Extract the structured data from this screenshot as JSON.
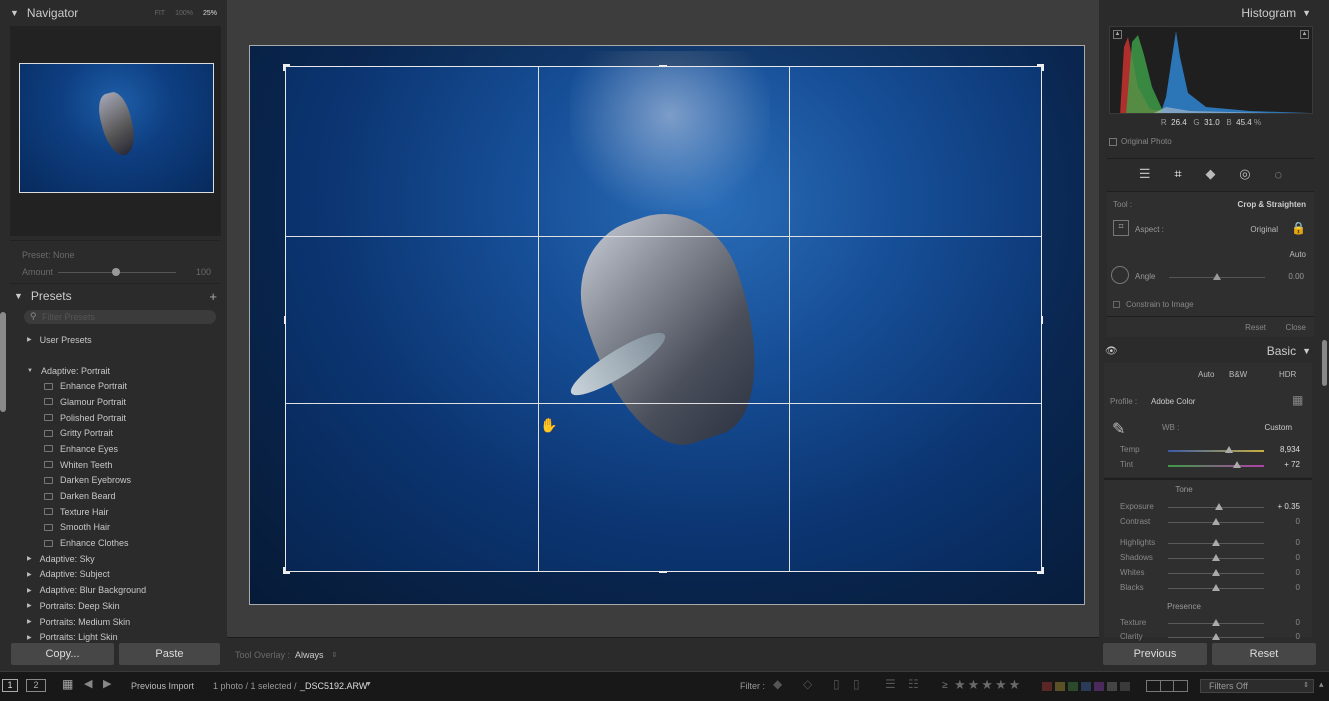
{
  "navigator": {
    "title": "Navigator",
    "fit": "FIT",
    "zoom1": "100%",
    "zoom2": "25%"
  },
  "preset_amount": {
    "preset_label": "Preset: None",
    "amount_label": "Amount",
    "amount_value": "100"
  },
  "presets": {
    "title": "Presets",
    "add": "+",
    "search_placeholder": "Filter Presets",
    "items": [
      {
        "type": "group",
        "label": "User Presets",
        "expanded": false
      },
      {
        "type": "group",
        "label": "Adaptive: Portrait",
        "expanded": true
      },
      {
        "type": "child",
        "label": "Enhance Portrait"
      },
      {
        "type": "child",
        "label": "Glamour Portrait"
      },
      {
        "type": "child",
        "label": "Polished Portrait"
      },
      {
        "type": "child",
        "label": "Gritty Portrait"
      },
      {
        "type": "child",
        "label": "Enhance Eyes"
      },
      {
        "type": "child",
        "label": "Whiten Teeth"
      },
      {
        "type": "child",
        "label": "Darken Eyebrows"
      },
      {
        "type": "child",
        "label": "Darken Beard"
      },
      {
        "type": "child",
        "label": "Texture Hair"
      },
      {
        "type": "child",
        "label": "Smooth Hair"
      },
      {
        "type": "child",
        "label": "Enhance Clothes"
      },
      {
        "type": "group",
        "label": "Adaptive: Sky",
        "expanded": false
      },
      {
        "type": "group",
        "label": "Adaptive: Subject",
        "expanded": false
      },
      {
        "type": "group",
        "label": "Adaptive: Blur Background",
        "expanded": false
      },
      {
        "type": "group",
        "label": "Portraits: Deep Skin",
        "expanded": false
      },
      {
        "type": "group",
        "label": "Portraits: Medium Skin",
        "expanded": false
      },
      {
        "type": "group",
        "label": "Portraits: Light Skin",
        "expanded": false
      }
    ]
  },
  "left_buttons": {
    "copy": "Copy...",
    "paste": "Paste"
  },
  "toolbar": {
    "overlay_label": "Tool Overlay :",
    "overlay_value": "Always"
  },
  "histogram": {
    "title": "Histogram",
    "r_label": "R",
    "r_value": "26.4",
    "g_label": "G",
    "g_value": "31.0",
    "b_label": "B",
    "b_value": "45.4",
    "unit": "%",
    "original_photo": "Original Photo"
  },
  "crop_tool": {
    "tool_label": "Tool :",
    "tool_name": "Crop & Straighten",
    "aspect_label": "Aspect :",
    "aspect_value": "Original",
    "auto": "Auto",
    "angle_label": "Angle",
    "angle_value": "0.00",
    "angle_pos": 0.5,
    "constrain": "Constrain to Image",
    "reset": "Reset",
    "close": "Close"
  },
  "basic": {
    "title": "Basic",
    "auto": "Auto",
    "bw": "B&W",
    "hdr": "HDR",
    "profile_label": "Profile :",
    "profile_value": "Adobe Color",
    "wb_label": "WB :",
    "wb_value": "Custom",
    "tone_title": "Tone",
    "presence_title": "Presence",
    "wb_sliders": [
      {
        "label": "Temp",
        "value": "8,934",
        "pos": 0.64
      },
      {
        "label": "Tint",
        "value": "+ 72",
        "pos": 0.72
      }
    ],
    "tone_sliders": [
      {
        "label": "Exposure",
        "value": "+ 0.35",
        "pos": 0.53
      },
      {
        "label": "Contrast",
        "value": "0",
        "pos": 0.5
      },
      {
        "label": "Highlights",
        "value": "0",
        "pos": 0.5
      },
      {
        "label": "Shadows",
        "value": "0",
        "pos": 0.5
      },
      {
        "label": "Whites",
        "value": "0",
        "pos": 0.5
      },
      {
        "label": "Blacks",
        "value": "0",
        "pos": 0.5
      }
    ],
    "presence_sliders": [
      {
        "label": "Texture",
        "value": "0",
        "pos": 0.5
      },
      {
        "label": "Clarity",
        "value": "0",
        "pos": 0.5
      }
    ]
  },
  "right_buttons": {
    "previous": "Previous",
    "reset": "Reset"
  },
  "filmstrip": {
    "screen1": "1",
    "screen2": "2",
    "source": "Previous Import",
    "count": "1 photo / 1 selected /",
    "filename": "_DSC5192.ARW",
    "filter_label": "Filter :",
    "rating_op": "≥",
    "stars": "★★★★★",
    "filters_off": "Filters Off"
  }
}
